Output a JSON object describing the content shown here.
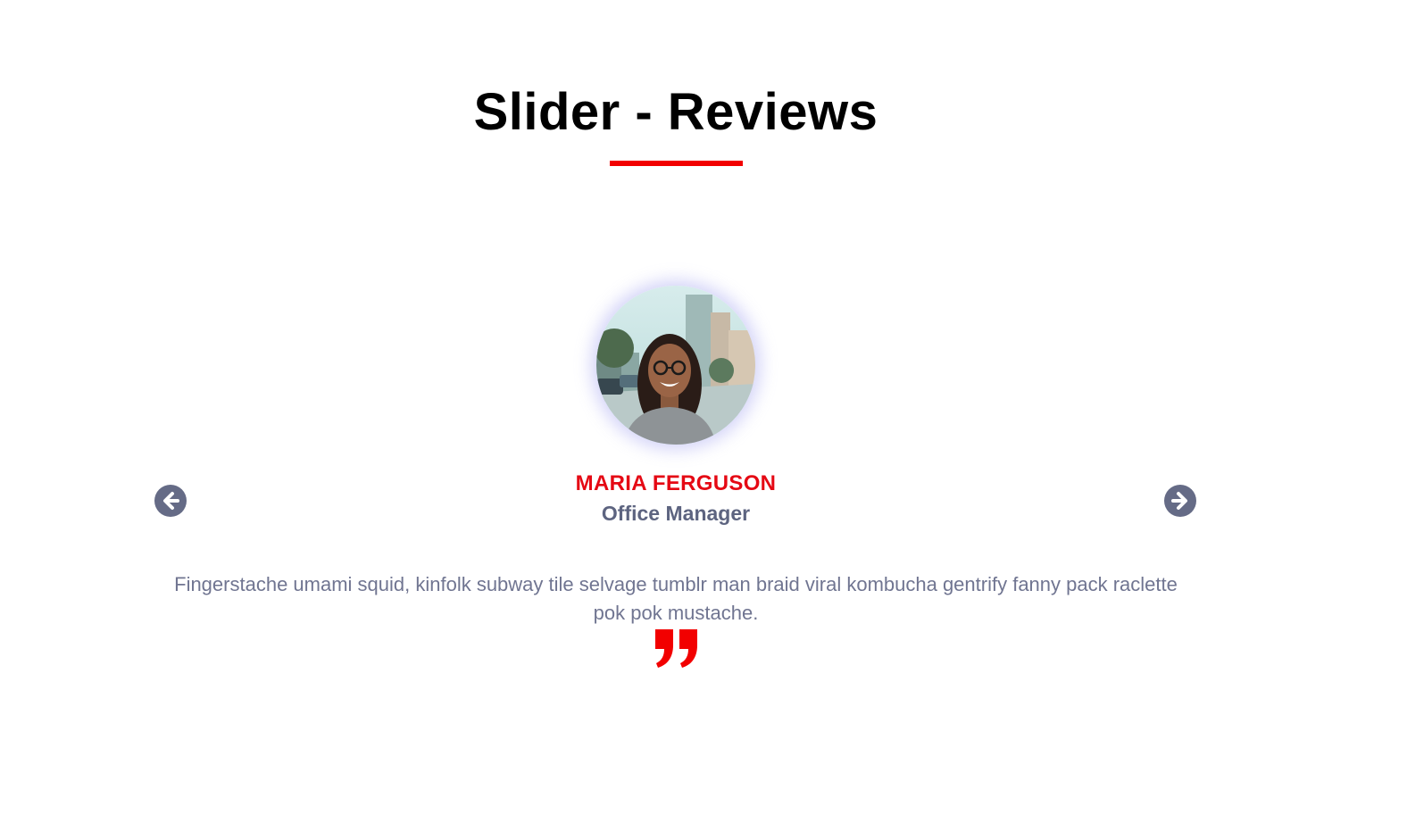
{
  "header": {
    "title": "Slider - Reviews"
  },
  "review": {
    "name": "MARIA FERGUSON",
    "role": "Office Manager",
    "text": "Fingerstache umami squid, kinfolk subway tile selvage tumblr man braid viral kombucha gentrify fanny pack raclette pok pok mustache."
  },
  "icons": {
    "prev": "arrow-left-circle-icon",
    "next": "arrow-right-circle-icon",
    "quote": "quote-right-icon"
  },
  "colors": {
    "accent": "#f20000",
    "name": "#e50914",
    "role": "#5d6480",
    "text": "#707591",
    "nav": "#656b86"
  }
}
